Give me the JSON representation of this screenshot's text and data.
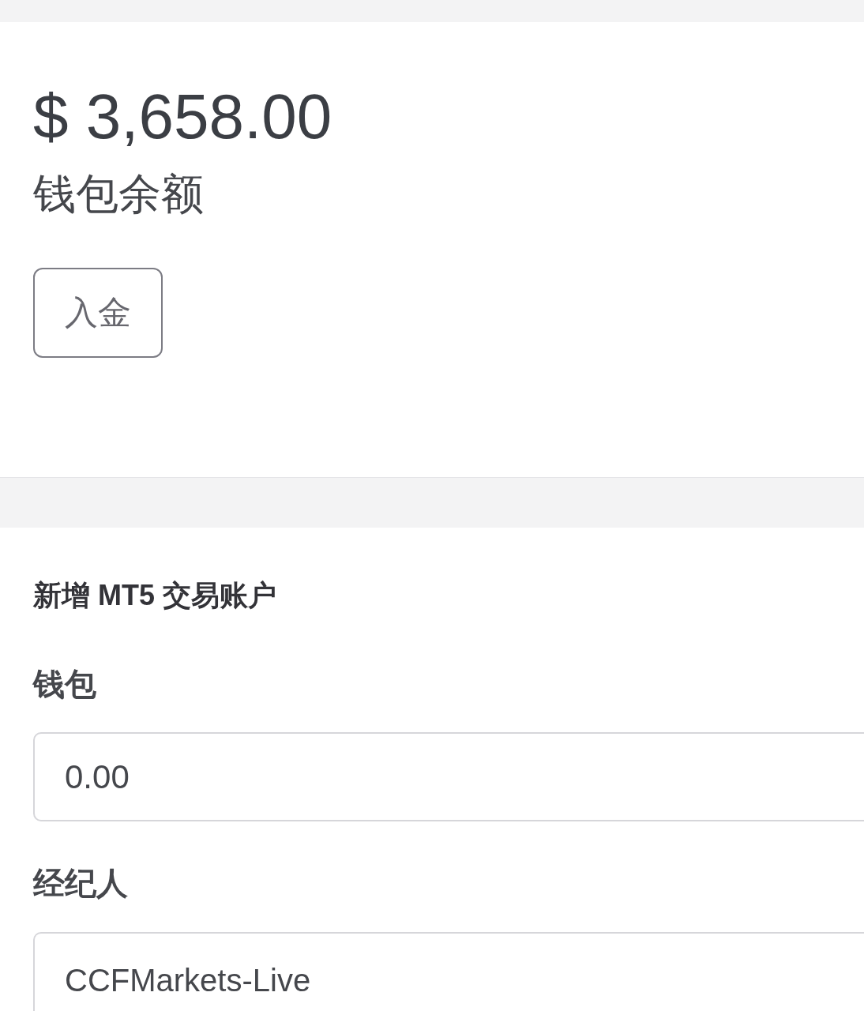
{
  "balance": {
    "amount": "$ 3,658.00",
    "label": "钱包余额"
  },
  "deposit_button": {
    "label": "入金"
  },
  "new_account_form": {
    "title": "新增 MT5 交易账户",
    "fields": [
      {
        "label": "钱包",
        "value": "0.00"
      },
      {
        "label": "经纪人",
        "value": "CCFMarkets-Live"
      }
    ]
  }
}
